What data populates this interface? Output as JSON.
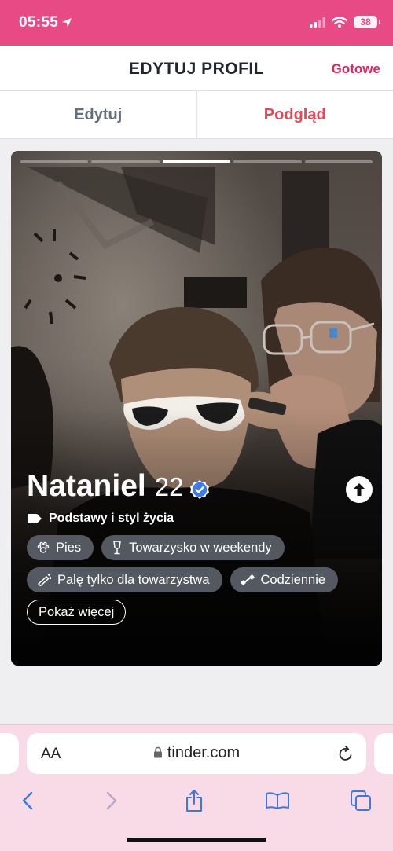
{
  "status_bar": {
    "time": "05:55",
    "battery": "38"
  },
  "header": {
    "title": "EDYTUJ PROFIL",
    "done_label": "Gotowe"
  },
  "tabs": [
    {
      "label": "Edytuj",
      "active": false
    },
    {
      "label": "Podgląd",
      "active": true
    }
  ],
  "profile": {
    "photo_count": 5,
    "active_photo": 2,
    "name": "Nataniel",
    "age": "22",
    "section_label": "Podstawy i styl życia",
    "chips": [
      {
        "icon": "paw-icon",
        "label": "Pies"
      },
      {
        "icon": "glass-icon",
        "label": "Towarzysko w weekendy"
      },
      {
        "icon": "cigarette-icon",
        "label": "Palę tylko dla towarzystwa"
      },
      {
        "icon": "dumbbell-icon",
        "label": "Codziennie"
      }
    ],
    "show_more_label": "Pokaż więcej"
  },
  "browser": {
    "aa_label": "AA",
    "url": "tinder.com"
  },
  "colors": {
    "brand": "#e84a86",
    "accent": "#e0245e",
    "tab_active": "#e04a58",
    "verified": "#3d79f1"
  }
}
